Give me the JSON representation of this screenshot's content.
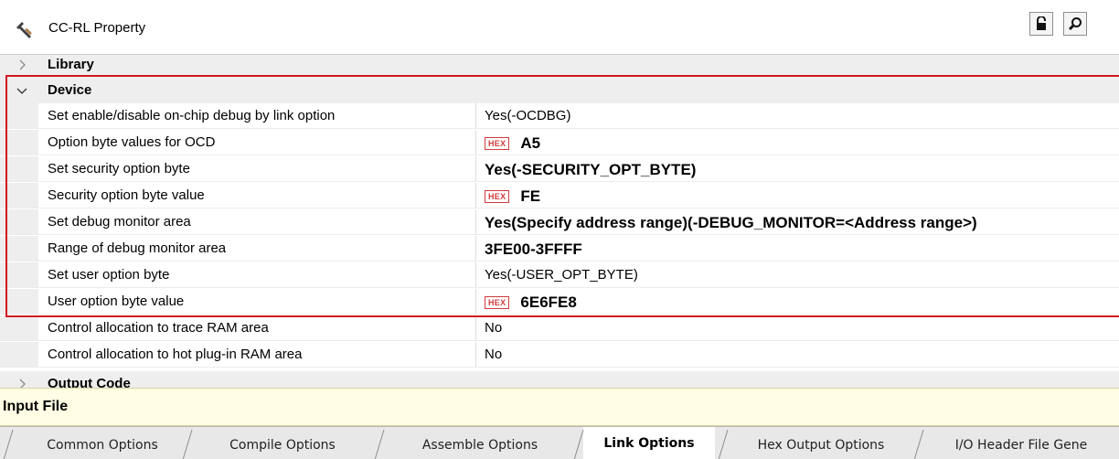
{
  "window": {
    "title": "CC-RL Property",
    "title_icon": "hammer-icon",
    "lock_icon": "lock-icon",
    "search_icon": "magnifier-icon"
  },
  "categories": {
    "library": "Library",
    "device": "Device",
    "output_code": "Output Code"
  },
  "device_properties": [
    {
      "name": "Set enable/disable on-chip debug by link option",
      "value": "Yes(-OCDBG)",
      "bold": false,
      "hex": false
    },
    {
      "name": "Option byte values for OCD",
      "value": "A5",
      "bold": true,
      "hex": true
    },
    {
      "name": "Set security option byte",
      "value": "Yes(-SECURITY_OPT_BYTE)",
      "bold": true,
      "hex": false
    },
    {
      "name": "Security option byte value",
      "value": "FE",
      "bold": true,
      "hex": true
    },
    {
      "name": "Set debug monitor area",
      "value": "Yes(Specify address range)(-DEBUG_MONITOR=<Address range>)",
      "bold": true,
      "hex": false
    },
    {
      "name": "Range of debug monitor area",
      "value": "3FE00-3FFFF",
      "bold": true,
      "hex": false
    },
    {
      "name": "Set user option byte",
      "value": "Yes(-USER_OPT_BYTE)",
      "bold": false,
      "hex": false
    },
    {
      "name": "User option byte value",
      "value": "6E6FE8",
      "bold": true,
      "hex": true
    },
    {
      "name": "Control allocation to trace RAM area",
      "value": "No",
      "bold": false,
      "hex": false
    },
    {
      "name": "Control allocation to hot plug-in RAM area",
      "value": "No",
      "bold": false,
      "hex": false
    }
  ],
  "hex_badge": "HEX",
  "description": {
    "title": "Input File"
  },
  "tabs": [
    {
      "label": "Common Options",
      "active": false
    },
    {
      "label": "Compile Options",
      "active": false
    },
    {
      "label": "Assemble Options",
      "active": false
    },
    {
      "label": "Link Options",
      "active": true
    },
    {
      "label": "Hex Output Options",
      "active": false
    },
    {
      "label": "I/O Header File Gene",
      "active": false
    }
  ],
  "colors": {
    "highlight_outline": "#d01722",
    "hex_badge": "#d13b3b",
    "description_bg": "#fffde3",
    "category_bg": "#eeeeee"
  }
}
